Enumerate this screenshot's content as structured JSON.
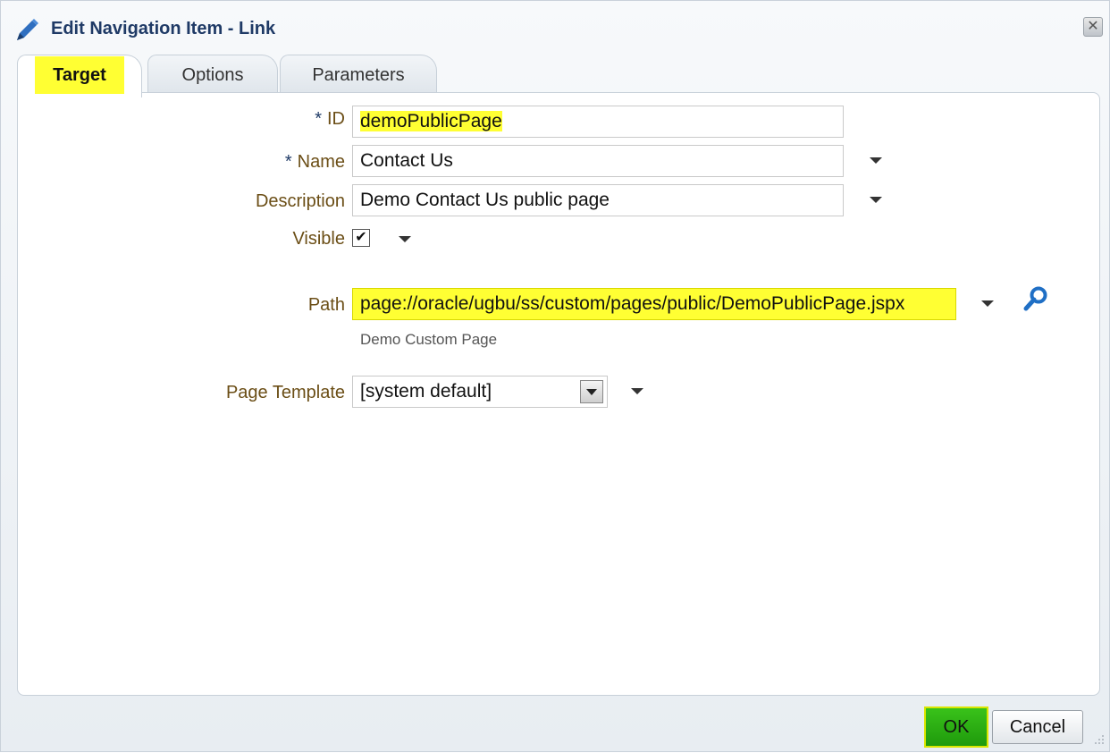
{
  "dialog": {
    "title": "Edit Navigation Item - Link",
    "title_icon": "pencil-icon",
    "close_icon": "close-icon"
  },
  "tabs": [
    {
      "label": "Target",
      "active": true
    },
    {
      "label": "Options",
      "active": false
    },
    {
      "label": "Parameters",
      "active": false
    }
  ],
  "form": {
    "required_marker": "*",
    "id": {
      "label": "ID",
      "value": "demoPublicPage"
    },
    "name": {
      "label": "Name",
      "value": "Contact Us"
    },
    "description": {
      "label": "Description",
      "value": "Demo Contact Us public page"
    },
    "visible": {
      "label": "Visible",
      "checked": true,
      "check_glyph": "✔"
    },
    "path": {
      "label": "Path",
      "value": "page://oracle/ugbu/ss/custom/pages/public/DemoPublicPage.jspx",
      "hint": "Demo Custom Page",
      "search_icon": "search-icon"
    },
    "page_template": {
      "label": "Page Template",
      "value": "[system default]"
    }
  },
  "footer": {
    "ok_label": "OK",
    "cancel_label": "Cancel"
  },
  "colors": {
    "highlight": "#ffff33",
    "title": "#1f3a66",
    "label": "#6b4e16",
    "ok_button": "#2aab14",
    "search_icon": "#1f6fc5"
  }
}
